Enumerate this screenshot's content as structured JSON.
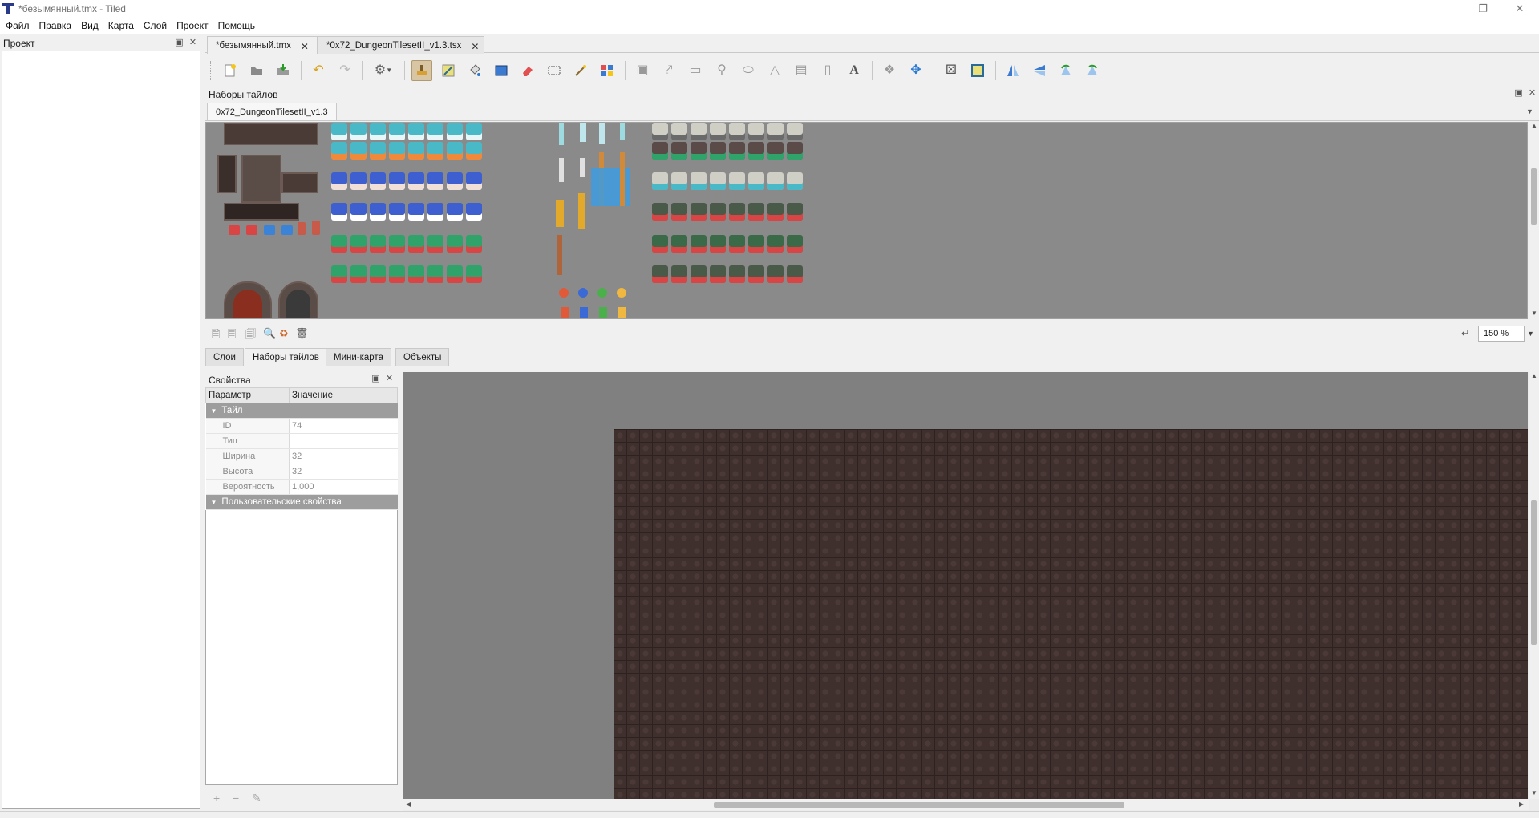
{
  "window": {
    "title": "*безымянный.tmx - Tiled",
    "minimize_icon": "minimize-icon",
    "restore_icon": "restore-icon",
    "close_icon": "close-icon"
  },
  "menu": [
    "Файл",
    "Правка",
    "Вид",
    "Карта",
    "Слой",
    "Проект",
    "Помощь"
  ],
  "project_panel": {
    "title": "Проект"
  },
  "document_tabs": [
    {
      "label": "*безымянный.tmx",
      "active": true
    },
    {
      "label": "*0x72_DungeonTilesetII_v1.3.tsx",
      "active": false
    }
  ],
  "tilesets_panel": {
    "title": "Наборы тайлов",
    "tab": "0x72_DungeonTilesetII_v1.3",
    "zoom": "150 %"
  },
  "lower_tabs": [
    {
      "label": "Слои",
      "active": false
    },
    {
      "label": "Наборы тайлов",
      "active": true
    },
    {
      "label": "Мини-карта",
      "active": false
    },
    {
      "label": "Объекты",
      "active": false
    }
  ],
  "properties_panel": {
    "title": "Свойства",
    "col_param": "Параметр",
    "col_value": "Значение",
    "group_tile": "Тайл",
    "rows": [
      {
        "key": "ID",
        "value": "74"
      },
      {
        "key": "Тип",
        "value": ""
      },
      {
        "key": "Ширина",
        "value": "32"
      },
      {
        "key": "Высота",
        "value": "32"
      },
      {
        "key": "Вероятность",
        "value": "1,000"
      }
    ],
    "group_custom": "Пользовательские свойства"
  },
  "colors": {
    "accent_selected_tile": "#3d9be0",
    "map_tile": "#3f302d",
    "canvas_bg": "#808080"
  }
}
